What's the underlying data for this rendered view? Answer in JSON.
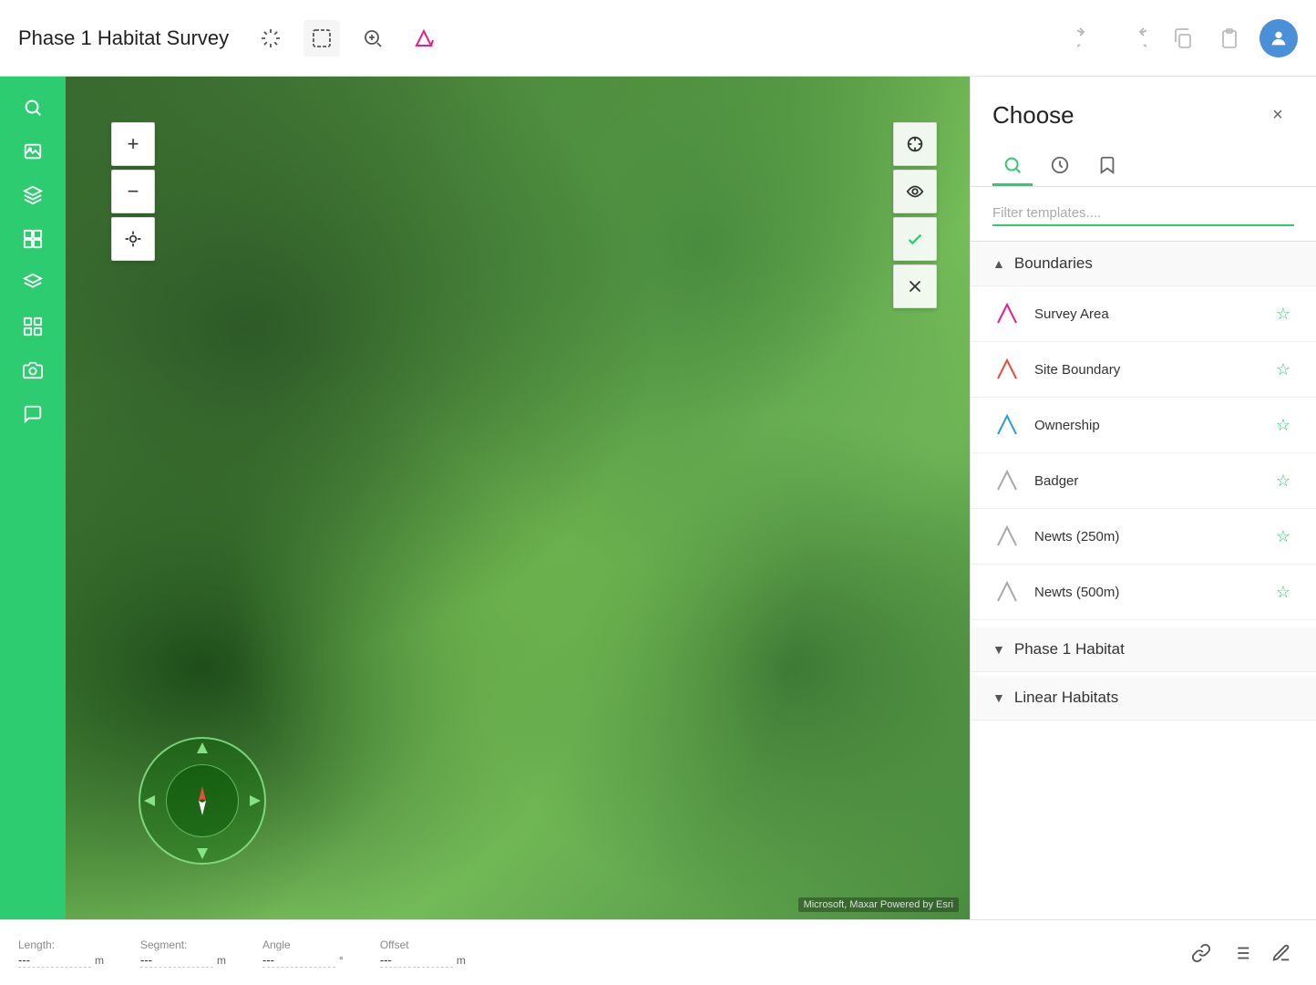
{
  "app": {
    "title": "Phase 1 Habitat Survey"
  },
  "toolbar": {
    "undo_label": "Undo",
    "redo_label": "Redo",
    "copy_label": "Copy",
    "paste_label": "Paste"
  },
  "map": {
    "zoom_in": "+",
    "zoom_out": "−",
    "attribution": "Microsoft, Maxar    Powered by Esri"
  },
  "choose_panel": {
    "title": "Choose",
    "close_label": "×",
    "filter_placeholder": "Filter templates....",
    "tabs": [
      {
        "id": "search",
        "label": "Search"
      },
      {
        "id": "recent",
        "label": "Recent"
      },
      {
        "id": "bookmarks",
        "label": "Bookmarks"
      }
    ],
    "categories": [
      {
        "id": "boundaries",
        "name": "Boundaries",
        "expanded": true,
        "items": [
          {
            "id": "survey-area",
            "name": "Survey Area",
            "icon": "pink-polygon",
            "starred": false
          },
          {
            "id": "site-boundary",
            "name": "Site Boundary",
            "icon": "red-polygon",
            "starred": false
          },
          {
            "id": "ownership",
            "name": "Ownership",
            "icon": "blue-polygon",
            "starred": false
          },
          {
            "id": "badger",
            "name": "Badger",
            "icon": "grey-polygon",
            "starred": false
          },
          {
            "id": "newts-250",
            "name": "Newts (250m)",
            "icon": "grey-polygon",
            "starred": false
          },
          {
            "id": "newts-500",
            "name": "Newts (500m)",
            "icon": "grey-polygon",
            "starred": false
          }
        ]
      },
      {
        "id": "phase1-habitat",
        "name": "Phase 1 Habitat",
        "expanded": false,
        "items": []
      },
      {
        "id": "linear-habitats",
        "name": "Linear Habitats",
        "expanded": false,
        "items": []
      }
    ]
  },
  "status_bar": {
    "length_label": "Length:",
    "length_value": "---",
    "length_unit": "m",
    "segment_label": "Segment:",
    "segment_value": "---",
    "segment_unit": "m",
    "angle_label": "Angle",
    "angle_value": "---",
    "angle_unit": "°",
    "offset_label": "Offset",
    "offset_value": "---",
    "offset_unit": "m"
  }
}
